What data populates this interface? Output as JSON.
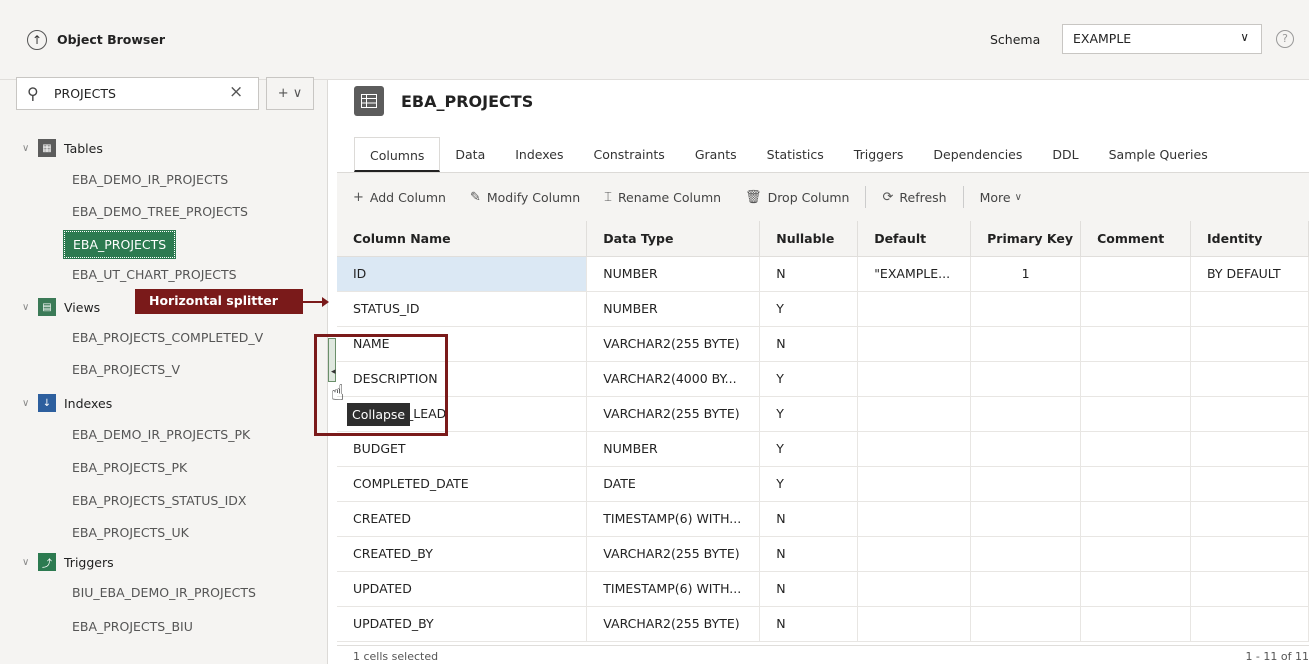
{
  "header": {
    "title": "Object Browser",
    "schema_label": "Schema",
    "schema_value": "EXAMPLE"
  },
  "sidebar": {
    "search_value": "PROJECTS",
    "add_button_label": "+ ∨",
    "groups": [
      {
        "label": "Tables",
        "icon": "table-icon",
        "items": [
          "EBA_DEMO_IR_PROJECTS",
          "EBA_DEMO_TREE_PROJECTS",
          "EBA_PROJECTS",
          "EBA_UT_CHART_PROJECTS"
        ]
      },
      {
        "label": "Views",
        "icon": "view-icon",
        "items": [
          "EBA_PROJECTS_COMPLETED_V",
          "EBA_PROJECTS_V"
        ]
      },
      {
        "label": "Indexes",
        "icon": "index-icon",
        "items": [
          "EBA_DEMO_IR_PROJECTS_PK",
          "EBA_PROJECTS_PK",
          "EBA_PROJECTS_STATUS_IDX",
          "EBA_PROJECTS_UK"
        ]
      },
      {
        "label": "Triggers",
        "icon": "trigger-icon",
        "items": [
          "BIU_EBA_DEMO_IR_PROJECTS",
          "EBA_PROJECTS_BIU"
        ]
      }
    ],
    "selected_item": "EBA_PROJECTS"
  },
  "annotation": {
    "label": "Horizontal splitter",
    "tooltip": "Collapse"
  },
  "main": {
    "object_title": "EBA_PROJECTS",
    "tabs": [
      "Columns",
      "Data",
      "Indexes",
      "Constraints",
      "Grants",
      "Statistics",
      "Triggers",
      "Dependencies",
      "DDL",
      "Sample Queries"
    ],
    "active_tab": "Columns",
    "toolbar": {
      "add_column": "Add Column",
      "modify_column": "Modify Column",
      "rename_column": "Rename Column",
      "drop_column": "Drop Column",
      "refresh": "Refresh",
      "more": "More"
    },
    "table": {
      "headers": [
        "Column Name",
        "Data Type",
        "Nullable",
        "Default",
        "Primary Key",
        "Comment",
        "Identity"
      ],
      "rows": [
        [
          "ID",
          "NUMBER",
          "N",
          "\"EXAMPLE...",
          "1",
          "",
          "BY DEFAULT"
        ],
        [
          "STATUS_ID",
          "NUMBER",
          "Y",
          "",
          "",
          "",
          ""
        ],
        [
          "NAME",
          "VARCHAR2(255 BYTE)",
          "N",
          "",
          "",
          "",
          ""
        ],
        [
          "DESCRIPTION",
          "VARCHAR2(4000 BY...",
          "Y",
          "",
          "",
          "",
          ""
        ],
        [
          "PROJECT_LEAD",
          "VARCHAR2(255 BYTE)",
          "Y",
          "",
          "",
          "",
          ""
        ],
        [
          "BUDGET",
          "NUMBER",
          "Y",
          "",
          "",
          "",
          ""
        ],
        [
          "COMPLETED_DATE",
          "DATE",
          "Y",
          "",
          "",
          "",
          ""
        ],
        [
          "CREATED",
          "TIMESTAMP(6) WITH...",
          "N",
          "",
          "",
          "",
          ""
        ],
        [
          "CREATED_BY",
          "VARCHAR2(255 BYTE)",
          "N",
          "",
          "",
          "",
          ""
        ],
        [
          "UPDATED",
          "TIMESTAMP(6) WITH...",
          "N",
          "",
          "",
          "",
          ""
        ],
        [
          "UPDATED_BY",
          "VARCHAR2(255 BYTE)",
          "N",
          "",
          "",
          "",
          ""
        ]
      ]
    },
    "status_left": "1 cells selected",
    "status_right": "1 - 11 of 11"
  }
}
